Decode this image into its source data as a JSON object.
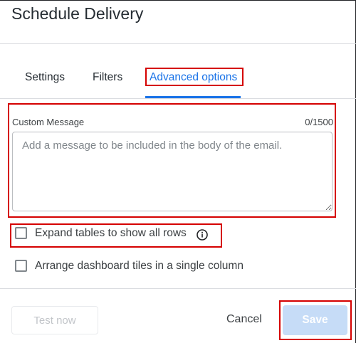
{
  "dialog": {
    "title": "Schedule Delivery"
  },
  "tabs": [
    {
      "label": "Settings",
      "active": false
    },
    {
      "label": "Filters",
      "active": false
    },
    {
      "label": "Advanced options",
      "active": true
    }
  ],
  "custom_message": {
    "label": "Custom Message",
    "counter": "0/1500",
    "value": "",
    "placeholder": "Add a message to be included in the body of the email."
  },
  "options": [
    {
      "label": "Expand tables to show all rows",
      "checked": false,
      "icon": "info-icon"
    },
    {
      "label": "Arrange dashboard tiles in a single column",
      "checked": false
    }
  ],
  "footer": {
    "test_label": "Test now",
    "cancel_label": "Cancel",
    "save_label": "Save"
  },
  "colors": {
    "accent": "#1a73e8",
    "highlight": "#d50000",
    "save_disabled_bg": "#c6dcf7"
  }
}
